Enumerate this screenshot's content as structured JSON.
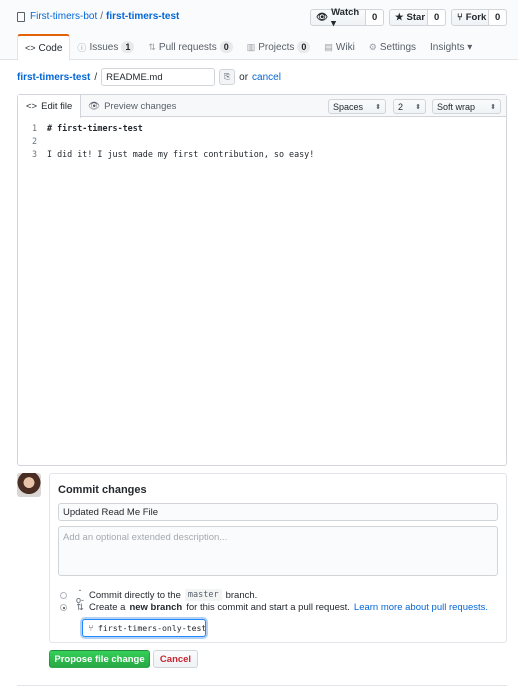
{
  "repo": {
    "owner": "First-timers-bot",
    "separator": "/",
    "name": "first-timers-test"
  },
  "actions": [
    {
      "icon": "👁",
      "label": "Watch ▾",
      "count": "0"
    },
    {
      "icon": "★",
      "label": "Star",
      "count": "0"
    },
    {
      "icon": "⑂",
      "label": "Fork",
      "count": "0"
    }
  ],
  "tabs": [
    {
      "icon": "<>",
      "label": "Code",
      "count": ""
    },
    {
      "icon": "ⓘ",
      "label": "Issues",
      "count": "1"
    },
    {
      "icon": "⇅",
      "label": "Pull requests",
      "count": "0"
    },
    {
      "icon": "▥",
      "label": "Projects",
      "count": "0"
    },
    {
      "icon": "▤",
      "label": "Wiki",
      "count": ""
    },
    {
      "icon": "⚙",
      "label": "Settings",
      "count": ""
    },
    {
      "icon": "",
      "label": "Insights ▾",
      "count": ""
    }
  ],
  "breadcrumb": {
    "root": "first-timers-test",
    "separator": "/",
    "filename": "README.md",
    "or": "or",
    "cancel": "cancel"
  },
  "editor": {
    "tabs": {
      "edit": "Edit file",
      "preview": "Preview changes"
    },
    "indent_mode": "Spaces",
    "indent_size": "2",
    "wrap_mode": "Soft wrap",
    "lines": [
      {
        "num": "1",
        "text": "# first-timers-test"
      },
      {
        "num": "2",
        "text": ""
      },
      {
        "num": "3",
        "text": "I did it! I just made my first contribution, so easy!"
      }
    ]
  },
  "commit": {
    "title": "Commit changes",
    "summary": "Updated Read Me File",
    "description_placeholder": "Add an optional extended description...",
    "option_direct": {
      "prefix": "Commit directly to the",
      "branch": "master",
      "suffix": "branch."
    },
    "option_new_branch": {
      "prefix": "Create a",
      "bold": "new branch",
      "middle": "for this commit and start a pull request.",
      "link": "Learn more about pull requests."
    },
    "branch_name": "first-timers-only-test",
    "propose_label": "Propose file change",
    "cancel_label": "Cancel"
  }
}
